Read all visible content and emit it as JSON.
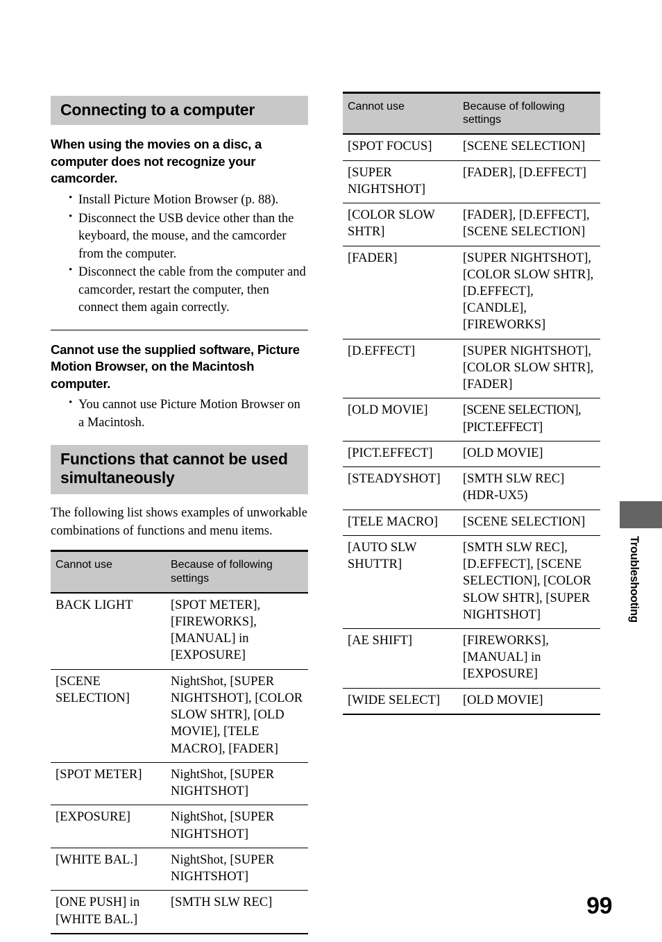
{
  "page": {
    "number": "99",
    "side_tab_label": "Troubleshooting"
  },
  "left_column": {
    "section1": {
      "banner": "Connecting to a computer",
      "sub1": {
        "heading": "When using the movies on a disc, a computer does not recognize your camcorder.",
        "bullets": [
          "Install Picture Motion Browser (p. 88).",
          "Disconnect the USB device other than the keyboard, the mouse, and the camcorder from the computer.",
          "Disconnect the cable from the computer and camcorder, restart the computer, then connect them again correctly."
        ]
      },
      "sub2": {
        "heading": "Cannot use the supplied software, Picture Motion Browser, on the Macintosh computer.",
        "bullets": [
          "You cannot use Picture Motion Browser on a Macintosh."
        ]
      }
    },
    "section2": {
      "banner": "Functions that cannot be used simultaneously",
      "intro": "The following list shows examples of unworkable combinations of functions and menu items."
    },
    "table": {
      "headers": [
        "Cannot use",
        "Because of following settings"
      ],
      "rows": [
        [
          "BACK LIGHT",
          "[SPOT METER], [FIREWORKS], [MANUAL] in [EXPOSURE]"
        ],
        [
          "[SCENE SELECTION]",
          "NightShot, [SUPER NIGHTSHOT], [COLOR SLOW SHTR], [OLD MOVIE], [TELE MACRO], [FADER]"
        ],
        [
          "[SPOT METER]",
          "NightShot, [SUPER NIGHTSHOT]"
        ],
        [
          "[EXPOSURE]",
          "NightShot, [SUPER NIGHTSHOT]"
        ],
        [
          "[WHITE BAL.]",
          "NightShot, [SUPER NIGHTSHOT]"
        ],
        [
          "[ONE PUSH] in [WHITE BAL.]",
          "[SMTH SLW REC]"
        ]
      ]
    }
  },
  "right_column": {
    "table": {
      "headers": [
        "Cannot use",
        "Because of following settings"
      ],
      "rows": [
        [
          "[SPOT FOCUS]",
          "[SCENE SELECTION]"
        ],
        [
          "[SUPER NIGHTSHOT]",
          "[FADER], [D.EFFECT]"
        ],
        [
          "[COLOR SLOW SHTR]",
          "[FADER], [D.EFFECT], [SCENE SELECTION]"
        ],
        [
          "[FADER]",
          "[SUPER NIGHTSHOT], [COLOR SLOW SHTR], [D.EFFECT], [CANDLE], [FIREWORKS]"
        ],
        [
          "[D.EFFECT]",
          "[SUPER NIGHTSHOT], [COLOR SLOW SHTR], [FADER]"
        ],
        [
          "[OLD MOVIE]",
          "[SCENE SELECTION], [PICT.EFFECT]"
        ],
        [
          "[PICT.EFFECT]",
          "[OLD MOVIE]"
        ],
        [
          "[STEADYSHOT]",
          "[SMTH SLW REC] (HDR-UX5)"
        ],
        [
          "[TELE MACRO]",
          "[SCENE SELECTION]"
        ],
        [
          "[AUTO SLW SHUTTR]",
          "[SMTH SLW REC], [D.EFFECT], [SCENE SELECTION], [COLOR SLOW SHTR], [SUPER NIGHTSHOT]"
        ],
        [
          "[AE SHIFT]",
          "[FIREWORKS], [MANUAL] in [EXPOSURE]"
        ],
        [
          "[WIDE SELECT]",
          "[OLD MOVIE]"
        ]
      ]
    }
  }
}
